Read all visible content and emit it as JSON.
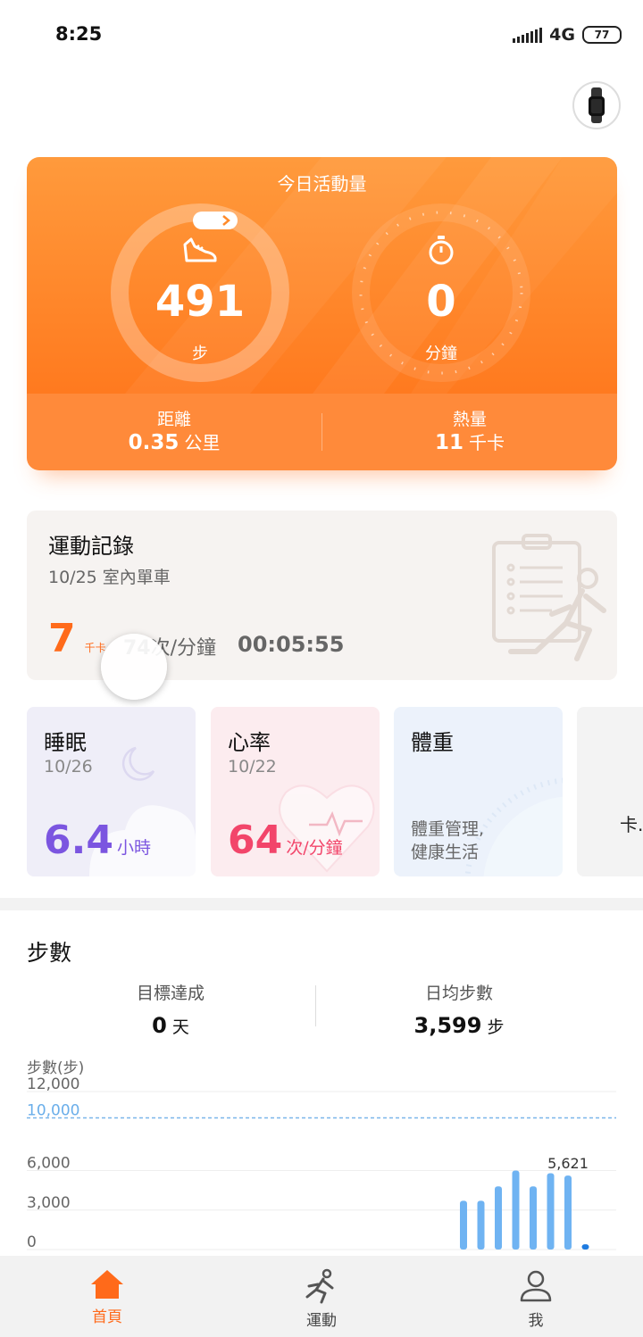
{
  "status_bar": {
    "time": "8:25",
    "network": "4G",
    "battery": "77"
  },
  "activity": {
    "title": "今日活動量",
    "steps": {
      "value": "491",
      "unit": "步",
      "icon": "shoe-icon"
    },
    "minutes": {
      "value": "0",
      "unit": "分鐘",
      "icon": "stopwatch-icon"
    },
    "distance": {
      "label": "距離",
      "value": "0.35",
      "unit": "公里"
    },
    "calories": {
      "label": "熱量",
      "value": "11",
      "unit": "千卡"
    }
  },
  "record": {
    "title": "運動記錄",
    "subtitle": "10/25  室內單車",
    "calories_value": "7",
    "calories_unit": "千卡",
    "hr_value": "74",
    "hr_unit": "次/分鐘",
    "duration": "00:05:55"
  },
  "cards": {
    "sleep": {
      "title": "睡眠",
      "date": "10/26",
      "value": "6.4",
      "unit": "小時"
    },
    "heart": {
      "title": "心率",
      "date": "10/22",
      "value": "64",
      "unit": "次/分鐘"
    },
    "weight": {
      "title": "體重",
      "desc_line1": "體重管理,",
      "desc_line2": "健康生活"
    },
    "more": {
      "text": "卡."
    }
  },
  "steps": {
    "title": "步數",
    "goal_label": "目標達成",
    "goal_value": "0",
    "goal_unit": "天",
    "avg_label": "日均步數",
    "avg_value": "3,599",
    "avg_unit": "步"
  },
  "chart_data": {
    "type": "bar",
    "ylabel": "步數(步)",
    "yticks": [
      "12,000",
      "6,000",
      "3,000",
      "0"
    ],
    "goal_label": "10,000",
    "goal_value": 10000,
    "ylim": [
      0,
      12000
    ],
    "values": [
      3700,
      3700,
      4800,
      6000,
      4800,
      5800,
      5621,
      400
    ],
    "annotation": "5,621",
    "annotation_index": 6,
    "bar_color": "#6fb3f2",
    "today_color": "#1e7be0"
  },
  "tabs": [
    {
      "label": "首頁",
      "icon": "home-icon",
      "active": true
    },
    {
      "label": "運動",
      "icon": "running-icon",
      "active": false
    },
    {
      "label": "我",
      "icon": "profile-icon",
      "active": false
    }
  ],
  "colors": {
    "accent": "#ff6a1a",
    "sleep": "#7b55e0",
    "heart": "#f2456a"
  }
}
